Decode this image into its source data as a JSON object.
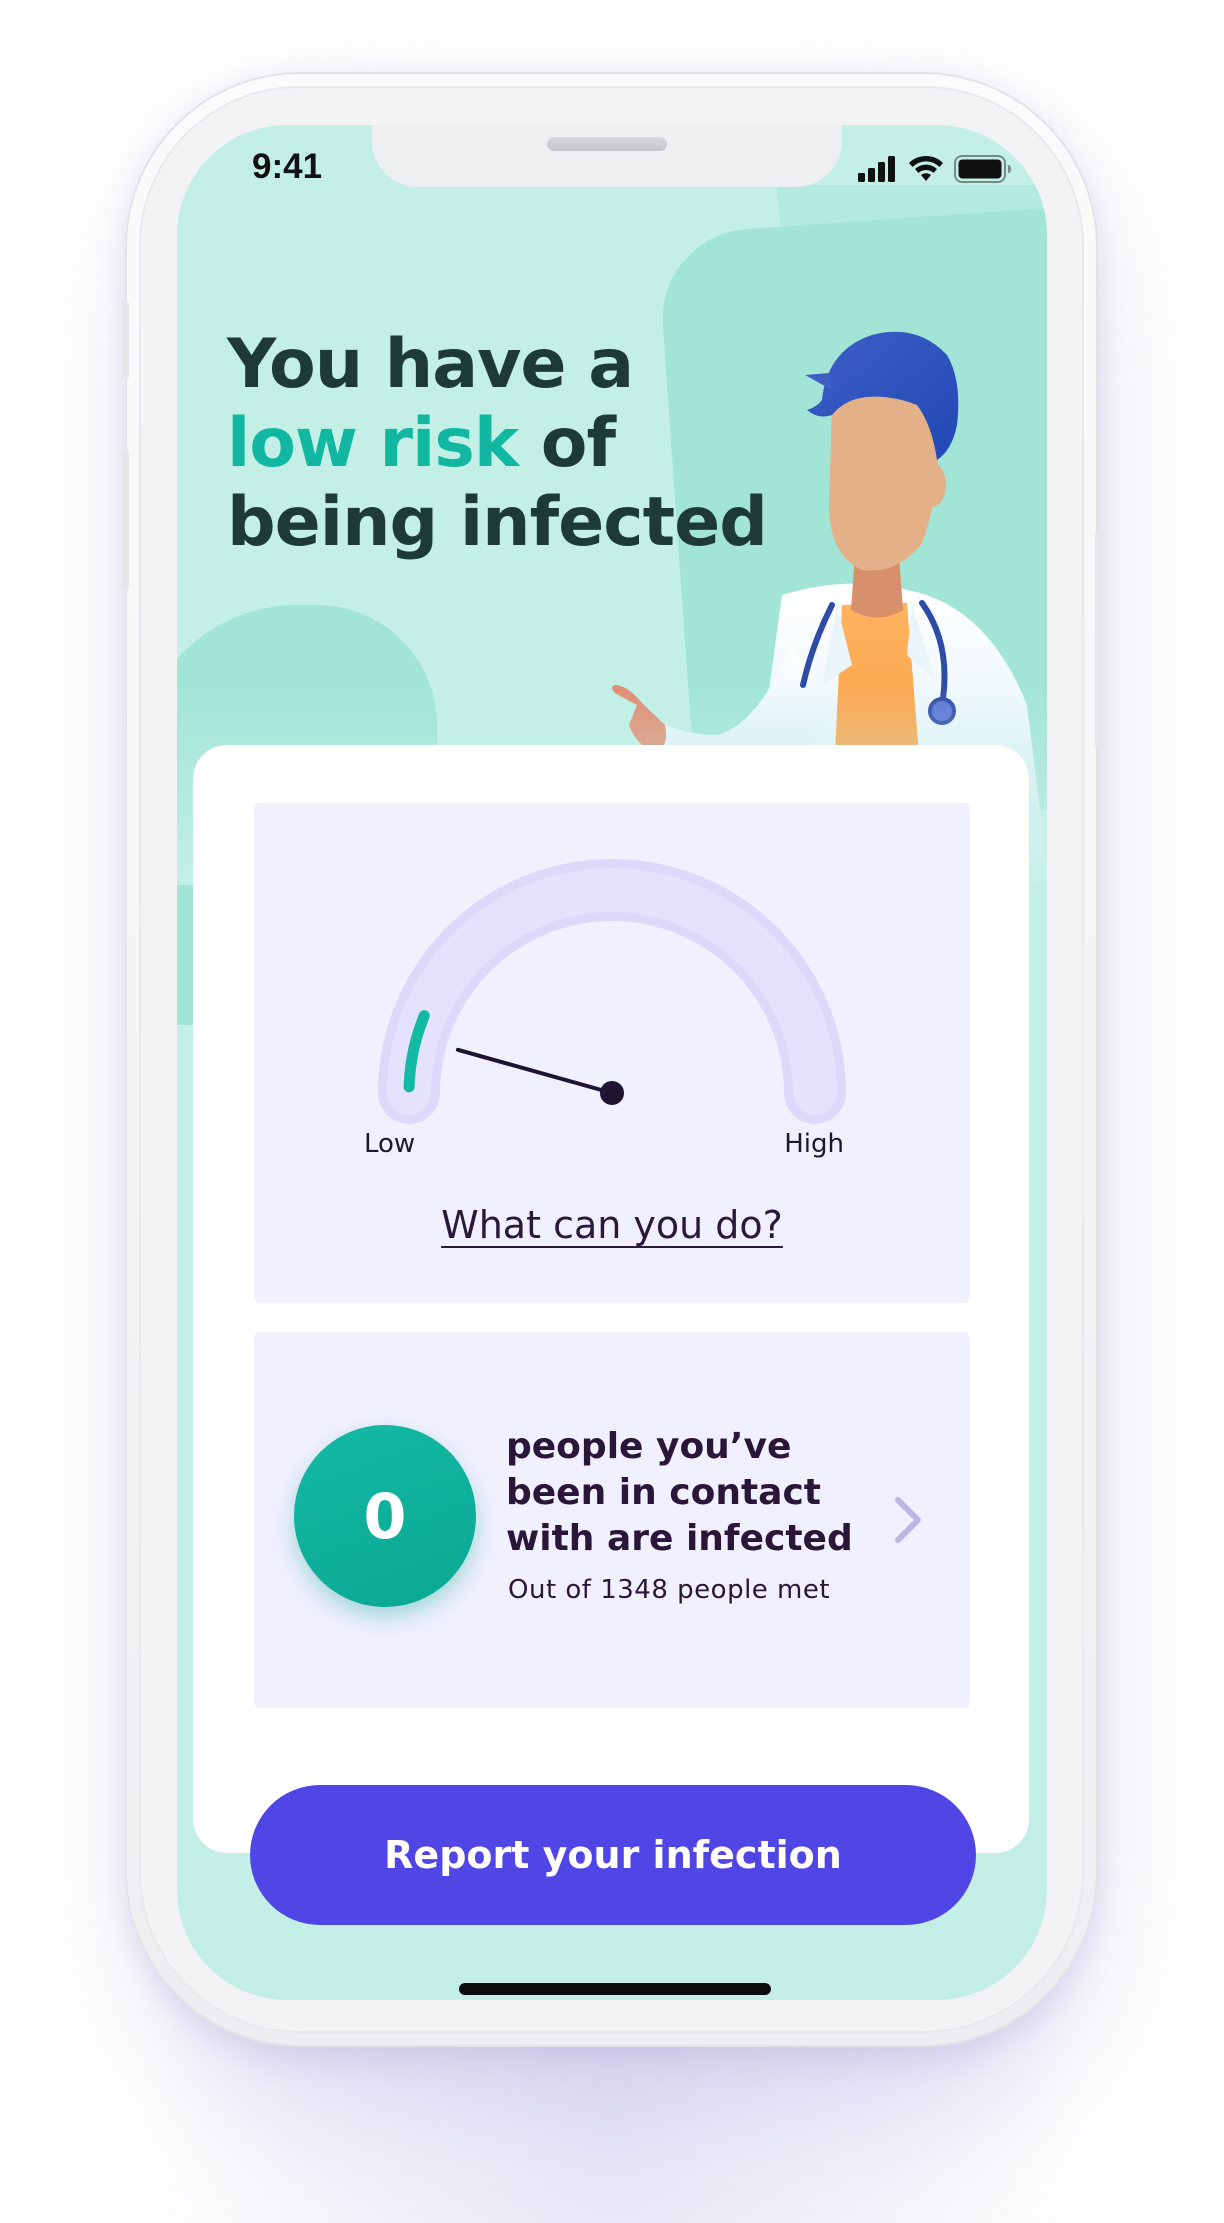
{
  "status_bar": {
    "time": "9:41",
    "icons": [
      "cellular-signal-icon",
      "wifi-icon",
      "battery-icon"
    ]
  },
  "headline": {
    "line1": "You have a",
    "accent": "low risk",
    "after_accent": " of",
    "line3": "being infected"
  },
  "illustration": {
    "icon": "doctor-illustration-icon"
  },
  "risk_gauge": {
    "low_label": "Low",
    "high_label": "High",
    "level": 0.08,
    "link_label": "What can you do?"
  },
  "contacts": {
    "count": "0",
    "message": "people you’ve been in contact with are infected",
    "subtitle": "Out of 1348 people met",
    "icon": "chevron-right-icon"
  },
  "cta": {
    "label": "Report your infection"
  },
  "colors": {
    "accent": "#12b7a2",
    "primary_button": "#4f46e5",
    "background": "#c3efe6",
    "panel": "#f1f0fe",
    "headline": "#1d3b34"
  }
}
